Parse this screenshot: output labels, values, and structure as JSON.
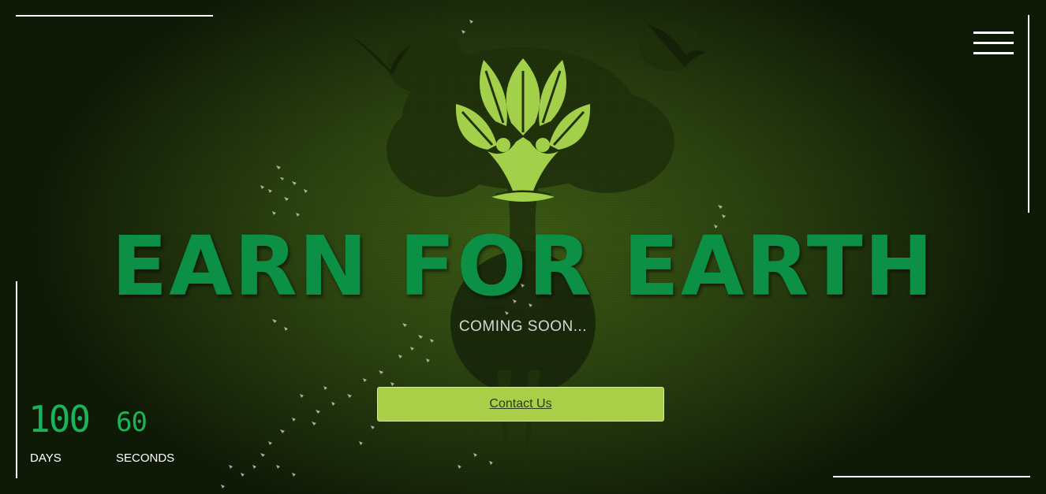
{
  "header": {
    "menu_icon": "hamburger-menu-icon"
  },
  "hero": {
    "logo_icon": "leaf-people-logo-icon",
    "title": "EARN FOR EARTH",
    "subtitle": "COMING SOON...",
    "contact_label": "Contact Us"
  },
  "countdown": {
    "days_value": "100",
    "days_label": "DAYS",
    "seconds_value": "60",
    "seconds_label": "SECONDS"
  },
  "colors": {
    "title_green": "#0b9046",
    "button_green": "#a8cf47",
    "leaf_green": "#a2d04a",
    "counter_green": "#19b457",
    "background": "#2c4410"
  }
}
